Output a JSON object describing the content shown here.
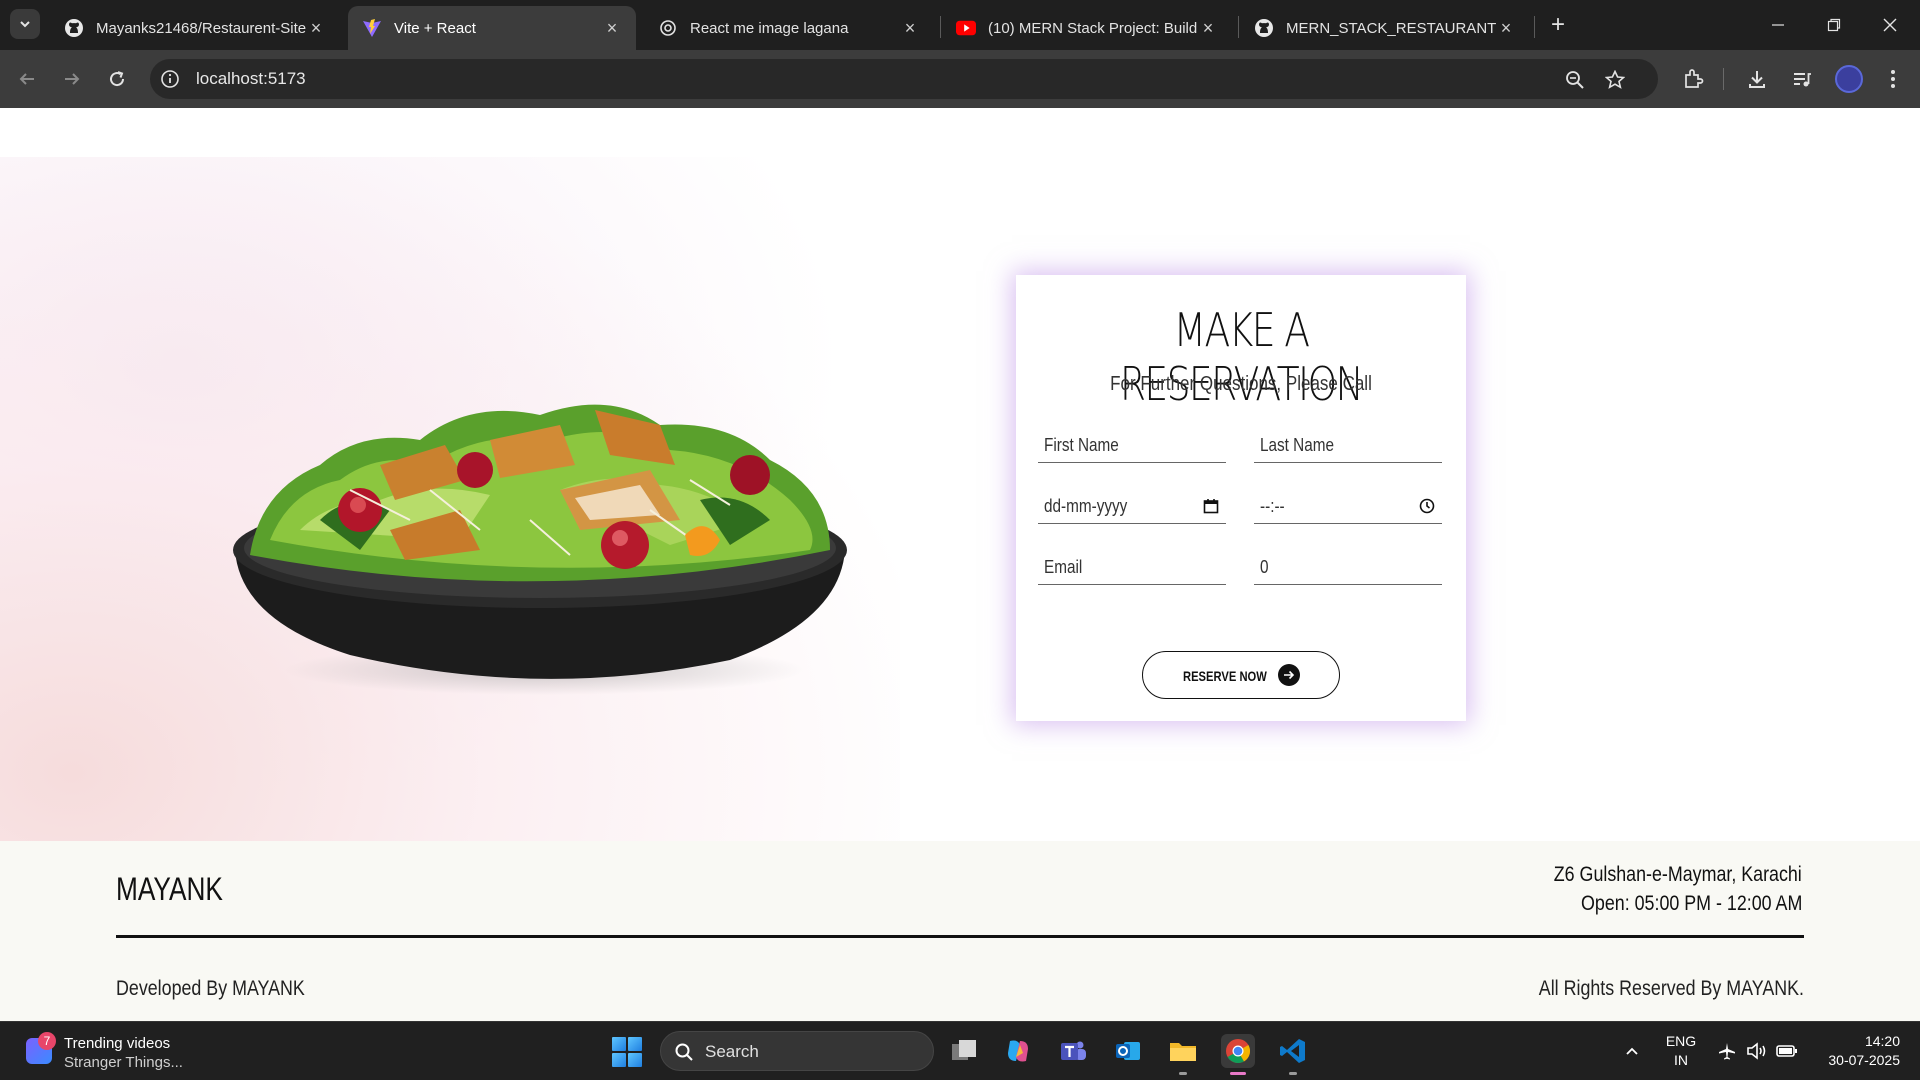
{
  "browser": {
    "tabs": [
      {
        "title": "Mayanks21468/Restaurent-Site",
        "icon": "github-icon",
        "active": false
      },
      {
        "title": "Vite + React",
        "icon": "vite-icon",
        "active": true
      },
      {
        "title": "React me image lagana",
        "icon": "chatgpt-icon",
        "active": false
      },
      {
        "title": "(10) MERN Stack Project: Build a",
        "icon": "youtube-icon",
        "active": false
      },
      {
        "title": "MERN_STACK_RESTAURANT_RE",
        "icon": "github-icon",
        "active": false
      }
    ],
    "url": "localhost:5173"
  },
  "reservation": {
    "title": "MAKE A RESERVATION",
    "subtitle": "For Further Questions, Please Call",
    "fields": {
      "first_name": "First Name",
      "last_name": "Last Name",
      "date": "dd-mm-yyyy",
      "time": "--:--",
      "email": "Email",
      "phone": "0"
    },
    "button_label": "RESERVE NOW"
  },
  "footer": {
    "brand": "MAYANK",
    "address": "Z6 Gulshan-e-Maymar, Karachi",
    "hours": "Open: 05:00 PM - 12:00 AM",
    "developed_by": "Developed By MAYANK",
    "rights": "All Rights Reserved By MAYANK."
  },
  "taskbar": {
    "widget_badge": "7",
    "widget_title": "Trending videos",
    "widget_subtitle": "Stranger Things...",
    "search_label": "Search",
    "lang_line1": "ENG",
    "lang_line2": "IN",
    "time": "14:20",
    "date": "30-07-2025"
  },
  "colors": {
    "chrome_dark": "#1f1f1f",
    "toolbar": "#3c3c3c",
    "card_glow": "#ba8ce6",
    "footer_bg": "#f9f9f4",
    "taskbar": "#202020"
  }
}
